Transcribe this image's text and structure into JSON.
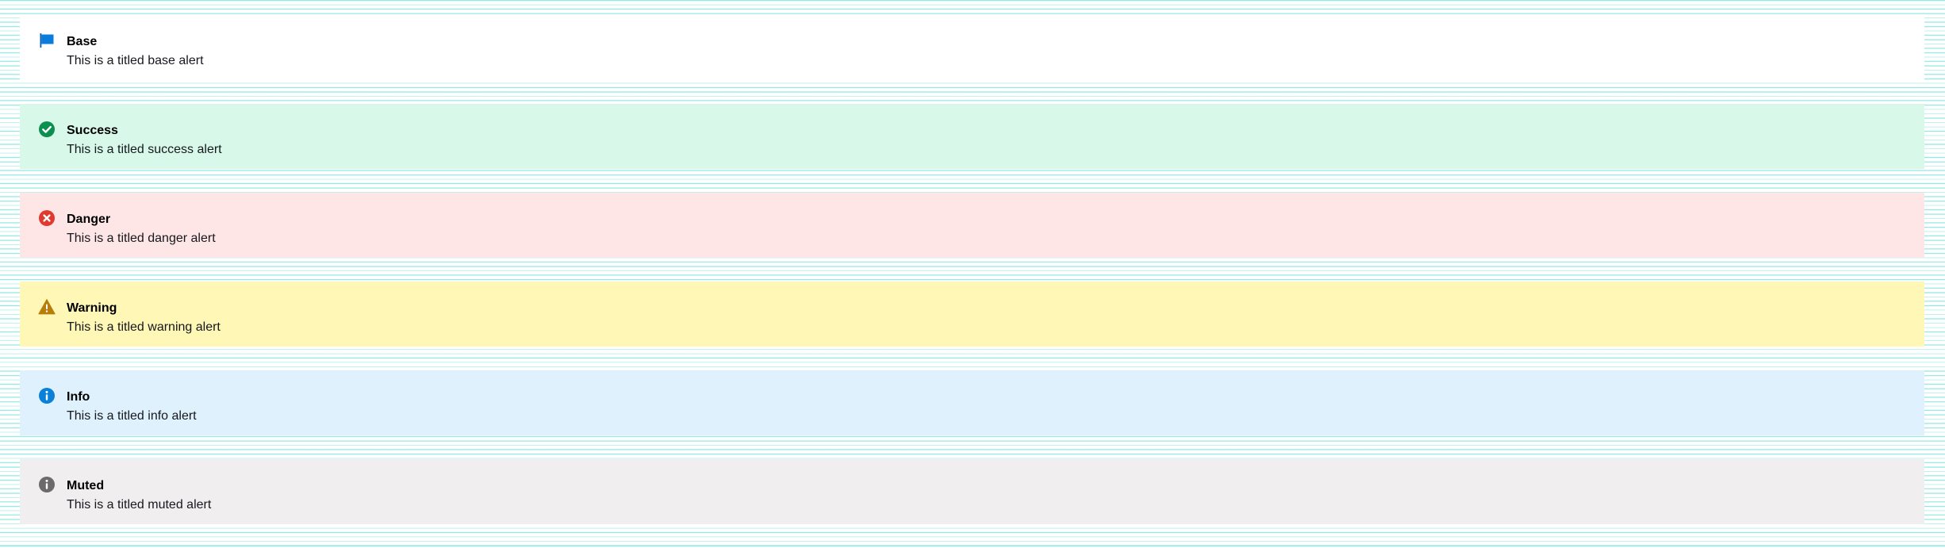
{
  "alerts": [
    {
      "key": "base",
      "title": "Base",
      "message": "This is a titled base alert",
      "icon": "flag-icon",
      "background": "#ffffff",
      "icon_color": "#0a7cdc"
    },
    {
      "key": "success",
      "title": "Success",
      "message": "This is a titled success alert",
      "icon": "check-circle-icon",
      "background": "#d8f8ea",
      "icon_color": "#0a8f4f"
    },
    {
      "key": "danger",
      "title": "Danger",
      "message": "This is a titled danger alert",
      "icon": "x-circle-icon",
      "background": "#ffe6e6",
      "icon_color": "#e03a2f"
    },
    {
      "key": "warning",
      "title": "Warning",
      "message": "This is a titled warning alert",
      "icon": "warning-triangle-icon",
      "background": "#fff7b6",
      "icon_color": "#b87d08"
    },
    {
      "key": "info",
      "title": "Info",
      "message": "This is a titled info alert",
      "icon": "info-circle-icon",
      "background": "#dff1fd",
      "icon_color": "#0a80d8"
    },
    {
      "key": "muted",
      "title": "Muted",
      "message": "This is a titled muted alert",
      "icon": "info-circle-icon",
      "background": "#f1eeef",
      "icon_color": "#6c6a6b"
    }
  ]
}
